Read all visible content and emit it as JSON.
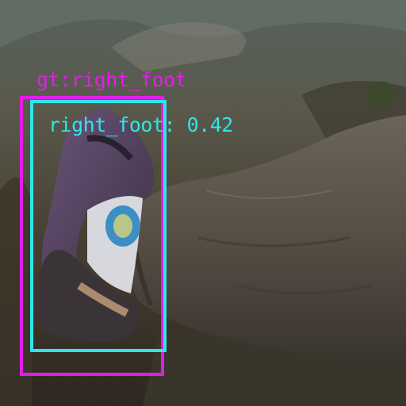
{
  "image": {
    "description_colors": {
      "sky_sea_haze": "#5d6b6c",
      "hillside": "#4a4636",
      "jeans": "#5a534b",
      "shoe_purple": "#5a4464",
      "sock": "#d9dbe0",
      "sock_patch": "#3b8fc4"
    }
  },
  "annotations": {
    "ground_truth": {
      "label": "gt:right_foot",
      "color": "#e21ee6"
    },
    "prediction": {
      "label": "right_foot: 0.42",
      "class": "right_foot",
      "confidence": 0.42,
      "color": "#2ee6ea"
    }
  }
}
